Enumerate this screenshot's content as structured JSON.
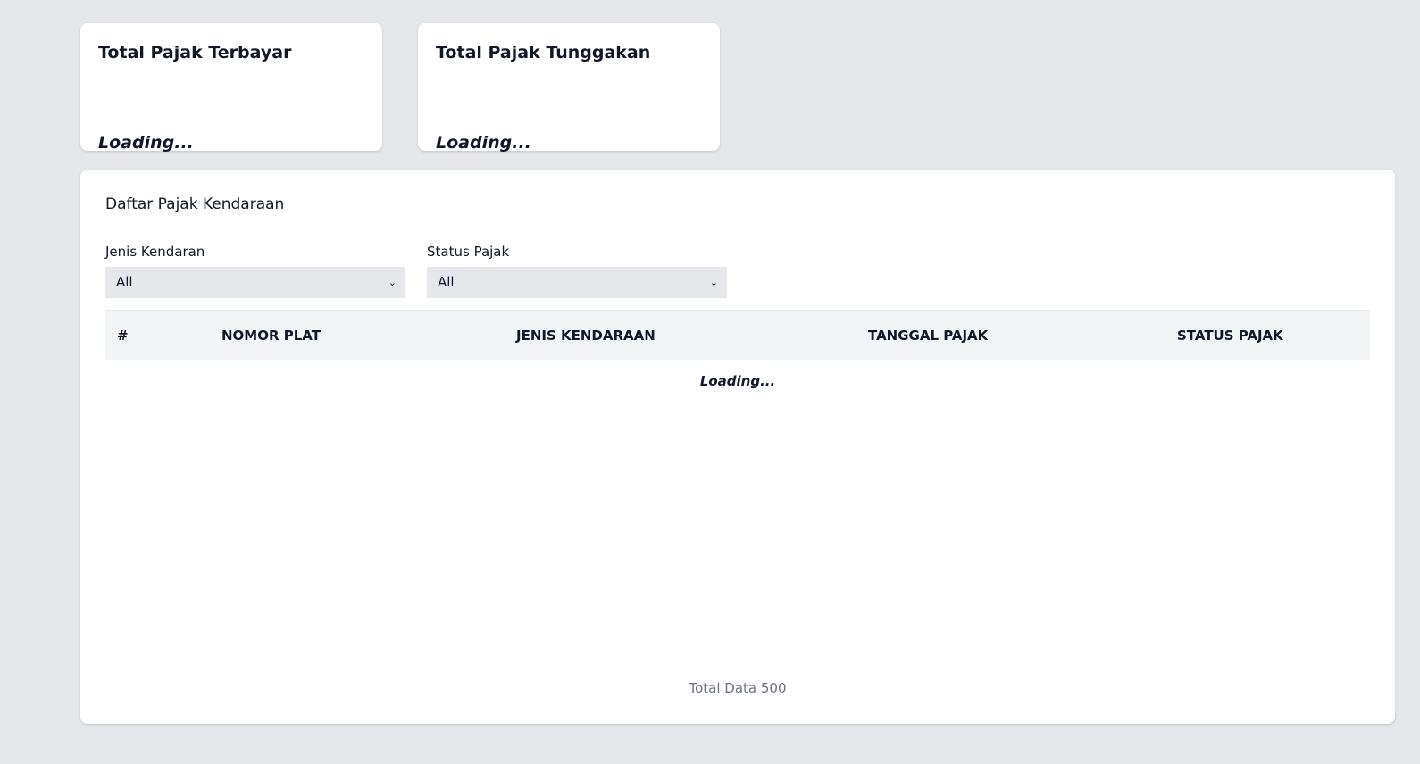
{
  "summary_cards": [
    {
      "title": "Total Pajak Terbayar",
      "value": "Loading..."
    },
    {
      "title": "Total Pajak Tunggakan",
      "value": "Loading..."
    }
  ],
  "panel": {
    "title": "Daftar Pajak Kendaraan",
    "filters": [
      {
        "label": "Jenis Kendaran",
        "selected": "All"
      },
      {
        "label": "Status Pajak",
        "selected": "All"
      }
    ],
    "table": {
      "columns": [
        "#",
        "NOMOR PLAT",
        "JENIS KENDARAAN",
        "TANGGAL PAJAK",
        "STATUS PAJAK"
      ],
      "status_message": "Loading..."
    },
    "footer": "Total Data 500"
  },
  "colors": {
    "page_background": "#e5e7eb",
    "card_background": "#ffffff",
    "table_header_background": "#f3f4f6",
    "muted_text": "#6b7280"
  },
  "icons": {
    "select_caret": "chevron-down-icon"
  }
}
